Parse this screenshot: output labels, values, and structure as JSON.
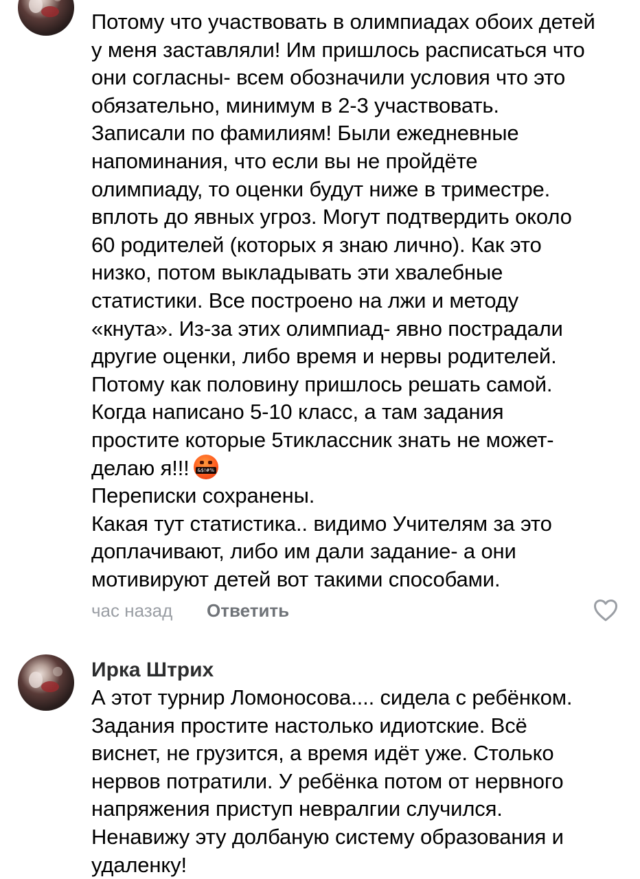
{
  "comments": [
    {
      "author": "",
      "text_before_emoji": "Потому что участвовать в олимпиадах обоих детей\nу меня заставляли! Им пришлось расписаться что\nони согласны- всем обозначили условия что это\nобязательно, минимум в 2-3 участвовать.\nЗаписали по фамилиям! Были ежедневные\nнапоминания, что если вы не пройдёте\nолимпиаду, то оценки будут ниже в триместре.\nвплоть до явных угроз. Могут подтвердить около\n60 родителей (которых я знаю лично). Как это\nнизко, потом выкладывать эти хвалебные\nстатистики. Все построено на лжи и методу\n«кнута». Из-за этих олимпиад- явно пострадали\nдругие оценки, либо время  и нервы родителей.\nПотому как половину пришлось решать самой.\nКогда написано 5-10 класс, а там задания\nпростите которые 5тиклассник знать не может-\nделаю я!!!",
      "emoji": "&$!#%",
      "emoji_icon": "face-with-symbols-on-mouth-icon",
      "text_after_emoji": "Переписки сохранены.\nКакая тут статистика.. видимо Учителям за это\nдоплачивают, либо им дали задание- а они\nмотивируют детей вот такими способами.",
      "time": "час назад",
      "reply_label": "Ответить",
      "like_icon": "heart-outline-icon"
    },
    {
      "author": "Ирка Штрих",
      "text": "А этот турнир Ломоносова.... сидела с ребёнком.\nЗадания простите настолько идиотские. Всё\nвиснет, не грузится, а время идёт уже. Столько\nнервов потратили. У ребёнка потом от нервного\nнапряжения приступ невралгии случился.\nНенавижу эту долбаную систему образования и\nудаленку!"
    }
  ],
  "colors": {
    "text": "#000000",
    "meta": "#9a9ea4",
    "reply": "#6f7378",
    "author": "#2c2d2e",
    "like": "#9a9ea4"
  }
}
